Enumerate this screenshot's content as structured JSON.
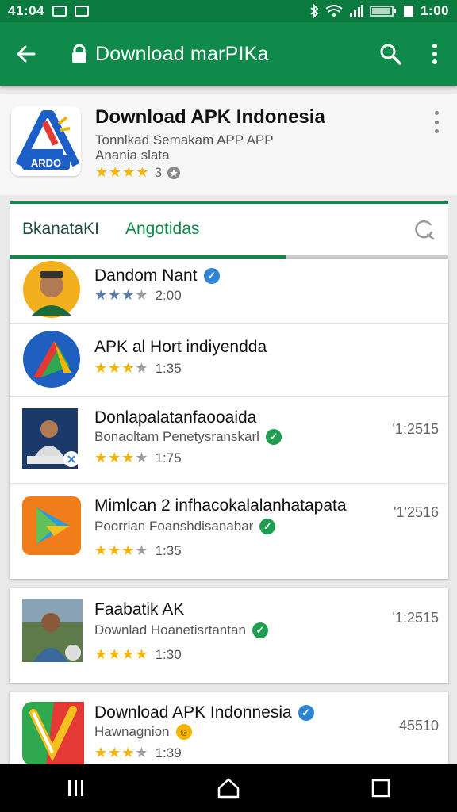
{
  "status_bar": {
    "time_left": "41:04",
    "time_right": "1:00"
  },
  "app_bar": {
    "title": "Download marPIKa"
  },
  "header": {
    "title": "Download APK Indonesia",
    "subtitle_line1": "Tonnlkad Semakam APP APP",
    "subtitle_line2": "Anania slata",
    "rating_stars": 4,
    "rating_count": "3"
  },
  "tabs": {
    "tab1": "BkanataKI",
    "tab2": "Angotidas",
    "active_fraction": 0.63
  },
  "colors": {
    "primary": "#0f8a4a",
    "status_bar": "#0a7a3f",
    "star": "#f4b400",
    "verified_green": "#1e9e4f",
    "verified_blue": "#2f84d6"
  },
  "apps": [
    {
      "title": "Dandom Nant",
      "subtitle": "",
      "badge": "blue",
      "stars": 3,
      "rating": "2:00",
      "meta": ""
    },
    {
      "title": "APK al Hort indiyendda",
      "subtitle": "",
      "badge": "",
      "stars": 3,
      "rating": "1:35",
      "meta": ""
    },
    {
      "title": "Donlapalatanfaooaida",
      "subtitle": "Bonaoltam Penetysranskarl",
      "badge": "green",
      "stars": 3,
      "rating": "1:75",
      "meta": "'1:2515"
    },
    {
      "title": "Mimlcan 2 infhacokalalanhatapata",
      "subtitle": "Poorrian Foanshdisanabar",
      "badge": "green",
      "stars": 3,
      "rating": "1:35",
      "meta": "'1'2516"
    },
    {
      "title": "Faabatik AK",
      "subtitle": "Downlad Hoanetisrtantan",
      "badge": "green",
      "stars": 4,
      "rating": "1:30",
      "meta": "'1:2515"
    },
    {
      "title": "Download APK Indonnesia",
      "subtitle": "Hawnagnion",
      "badge": "blue",
      "stars": 3,
      "rating": "1:39",
      "meta": "45510"
    }
  ],
  "nav": {
    "recents_icon": "recents-icon",
    "home_icon": "home-icon",
    "back_icon": "overview-icon"
  }
}
